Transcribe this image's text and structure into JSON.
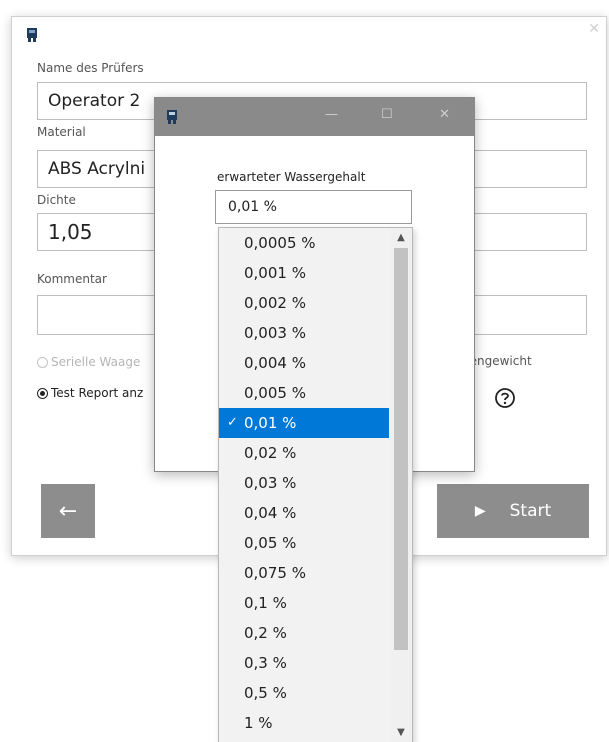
{
  "window": {
    "icon": "app-icon",
    "close_icon": "close-icon"
  },
  "form": {
    "name_label": "Name des Prüfers",
    "name_value": "Operator 2",
    "material_label": "Material",
    "material_value": "ABS  Acrylni",
    "density_label": "Dichte",
    "density_value": "1,05",
    "comment_label": "Kommentar",
    "comment_value": "",
    "radio_serial": "Serielle Waage",
    "radio_report": "Test Report anz",
    "right_text": "bengewicht"
  },
  "buttons": {
    "back_icon": "←",
    "start_icon": "▶",
    "start_label": "Start"
  },
  "dialog": {
    "minimize": "—",
    "maximize": "☐",
    "close": "✕",
    "label": "erwarteter Wassergehalt",
    "selected": "0,01 %"
  },
  "dropdown": {
    "check": "✓",
    "options": [
      "0,0005 %",
      "0,001 %",
      "0,002 %",
      "0,003 %",
      "0,004 %",
      "0,005 %",
      "0,01 %",
      "0,02 %",
      "0,03 %",
      "0,04 %",
      "0,05 %",
      "0,075 %",
      "0,1 %",
      "0,2 %",
      "0,3 %",
      "0,5 %",
      "1 %"
    ],
    "selected_index": 6,
    "scroll_up": "▲",
    "scroll_down": "▼"
  },
  "colors": {
    "accent": "#0078d7",
    "button_bg": "#8d8d8d",
    "dialog_titlebar": "#8a8a8a"
  }
}
